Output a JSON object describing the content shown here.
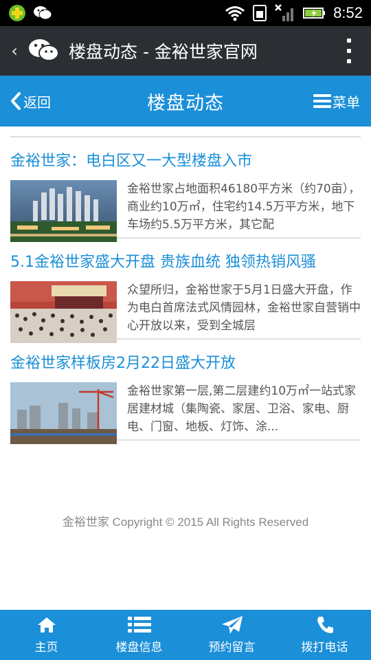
{
  "statusbar": {
    "time": "8:52",
    "icons": [
      "plus-app-icon",
      "wechat-notification-icon",
      "wifi-icon",
      "sim-icon",
      "signal-icon",
      "battery-charging-icon"
    ]
  },
  "wechat_bar": {
    "title": "楼盘动态 - 金裕世家官网",
    "back_icon": "chevron-left-icon",
    "logo_icon": "wechat-logo-icon",
    "more_icon": "more-vertical-icon"
  },
  "site_header": {
    "back_label": "返回",
    "title": "楼盘动态",
    "menu_label": "菜单"
  },
  "news": [
    {
      "title": "金裕世家：电白区又一大型楼盘入市",
      "summary": "金裕世家占地面积46180平方米（约70亩），商业约10万㎡，住宅约14.5万平方米，地下车场约5.5万平方米，其它配",
      "thumb": "aerial-city-render"
    },
    {
      "title": "5.1金裕世家盛大开盘 贵族血统 独领热销风骚",
      "summary": "众望所归，金裕世家于5月1日盛大开盘，作为电白首席法式风情园林，金裕世家自营销中心开放以来，受到全城层",
      "thumb": "opening-crowd-photo"
    },
    {
      "title": "金裕世家样板房2月22日盛大开放",
      "summary": "金裕世家第一层,第二层建约10万㎡一站式家居建材城（集陶瓷、家居、卫浴、家电、厨电、门窗、地板、灯饰、涂...",
      "thumb": "construction-site-photo"
    }
  ],
  "footer": {
    "copyright": "金裕世家 Copyright © 2015 All Rights Reserved"
  },
  "bottom_nav": [
    {
      "label": "主页",
      "icon": "home-icon"
    },
    {
      "label": "楼盘信息",
      "icon": "list-icon"
    },
    {
      "label": "预约留言",
      "icon": "paper-plane-icon"
    },
    {
      "label": "拨打电话",
      "icon": "phone-icon"
    }
  ],
  "colors": {
    "accent": "#1b8fd8",
    "wechat_bar": "#2b2f33",
    "text_gray": "#555555"
  }
}
